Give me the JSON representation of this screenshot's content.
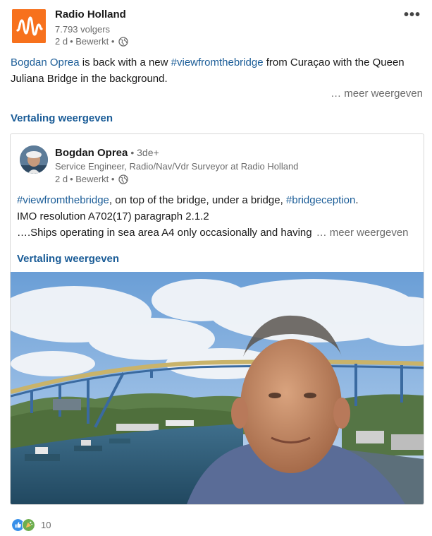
{
  "colors": {
    "brand": "#f7711d",
    "link": "#1a5c97",
    "muted": "#6b6b6b"
  },
  "org": {
    "name": "Radio Holland",
    "followers": "7.793 volgers",
    "time": "2 d",
    "edited": "• Bewerkt •"
  },
  "post": {
    "mention": "Bogdan Oprea",
    "text1": " is back with a new ",
    "hashtag": "#viewfromthebridge",
    "text2": " from Curaçao  with the Queen Juliana Bridge in the background.",
    "see_more": "… meer weergeven",
    "translate": "Vertaling weergeven"
  },
  "shared": {
    "author": "Bogdan Oprea",
    "degree": "• 3de+",
    "headline": "Service Engineer, Radio/Nav/Vdr Surveyor at Radio Holland",
    "time": "2 d",
    "edited": "• Bewerkt •",
    "hashtag1": "#viewfromthebridge",
    "line1_mid": ", on top of the bridge, under a bridge, ",
    "hashtag2": "#bridgeception",
    "line1_end": ".",
    "line2": "IMO resolution A702(17) paragraph 2.1.2",
    "line3": "….Ships operating in sea area A4 only occasionally and having",
    "see_more": "… meer weergeven",
    "translate": "Vertaling weergeven"
  },
  "reactions": {
    "icons": [
      "like-icon",
      "celebrate-icon"
    ],
    "count": "10"
  }
}
